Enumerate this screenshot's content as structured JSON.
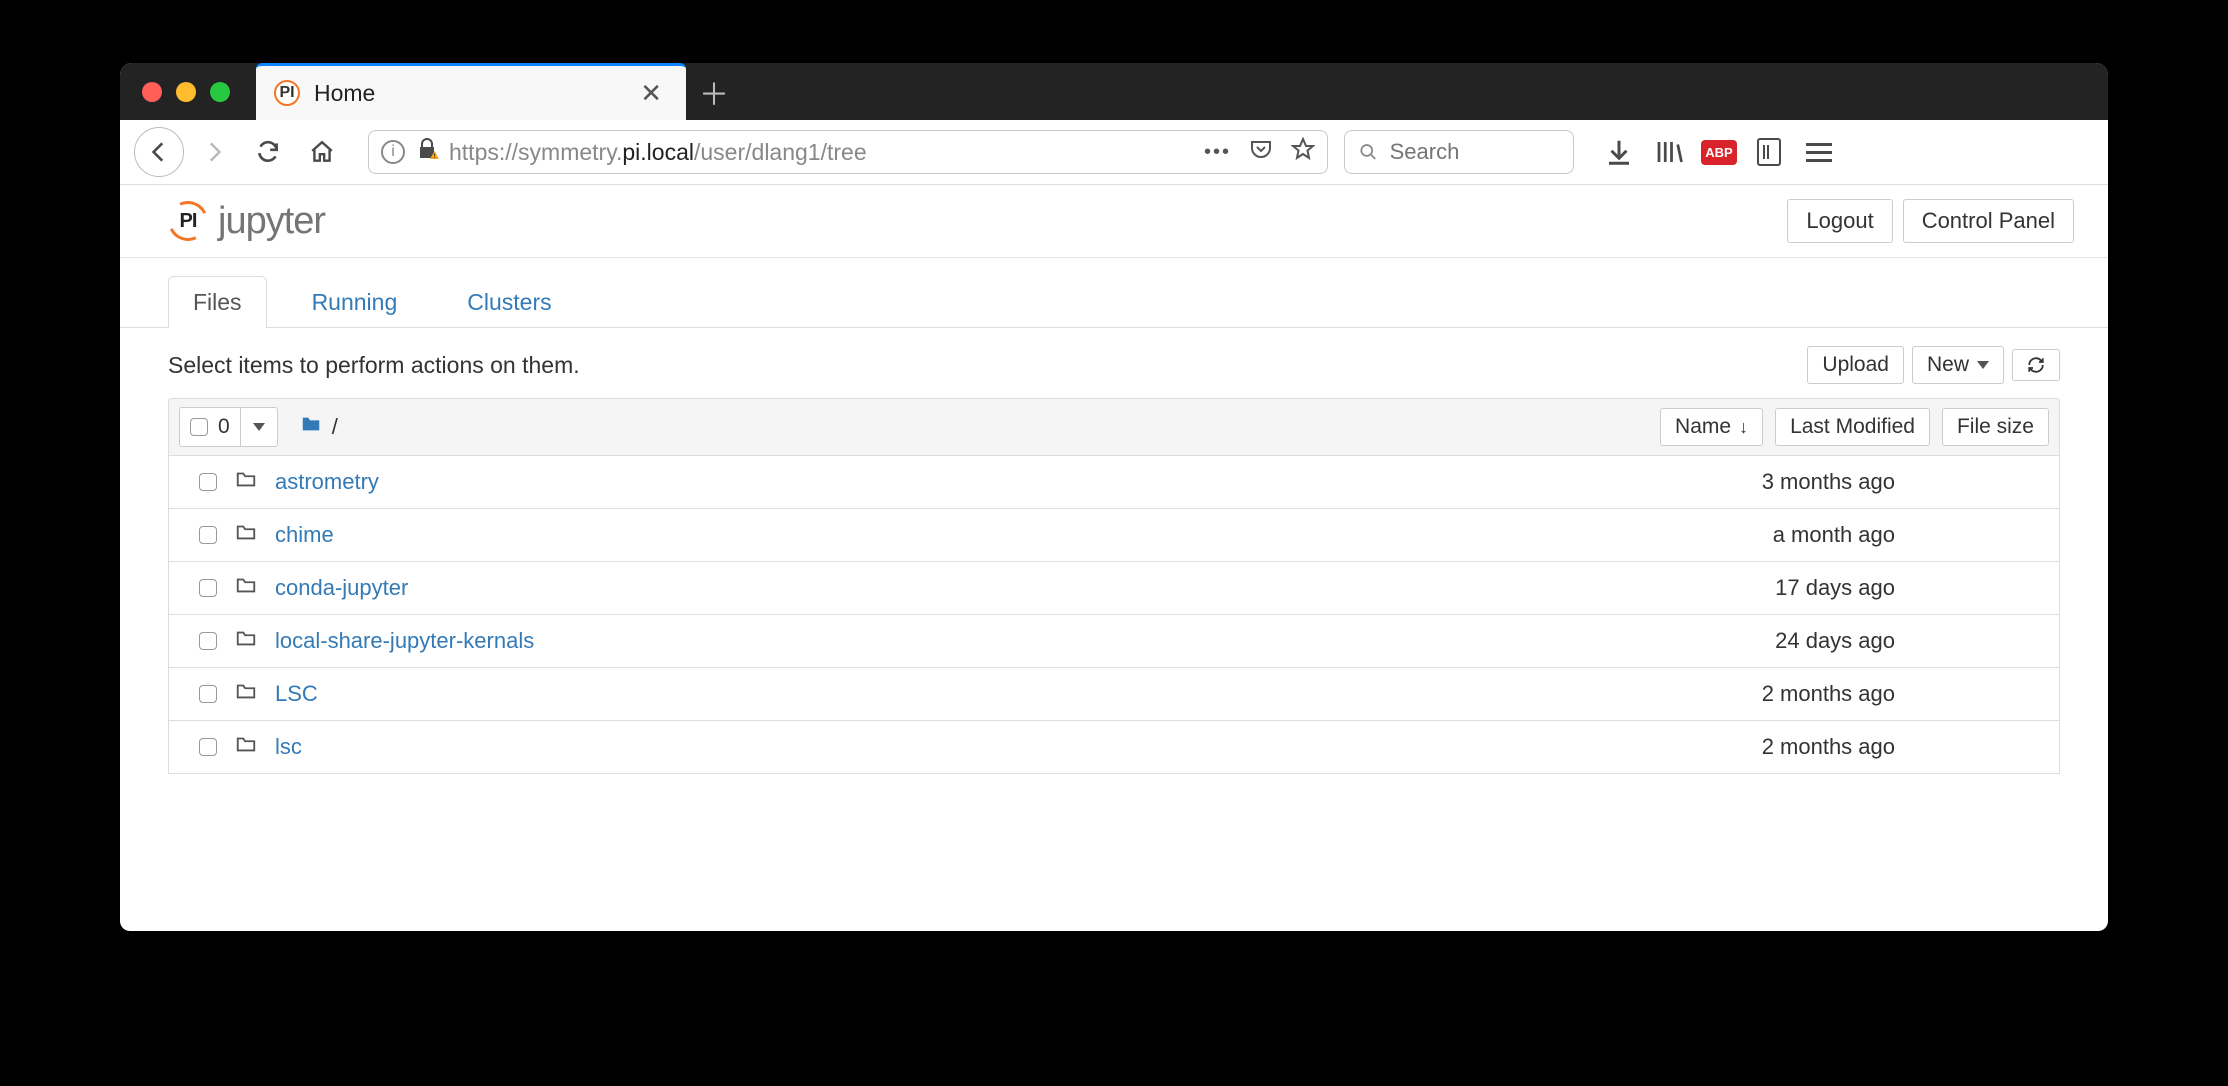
{
  "browser": {
    "tab_title": "Home",
    "url_prefix": "https://",
    "url_host_dim": "symmetry.",
    "url_host_bold": "pi.local",
    "url_path": "/user/dlang1/tree",
    "search_placeholder": "Search"
  },
  "jupyter": {
    "logo_text": "jupyter",
    "logout": "Logout",
    "control_panel": "Control Panel",
    "tabs": {
      "files": "Files",
      "running": "Running",
      "clusters": "Clusters"
    },
    "hint": "Select items to perform actions on them.",
    "upload": "Upload",
    "new": "New",
    "select_count": "0",
    "breadcrumb_slash": "/",
    "sort_name": "Name",
    "sort_modified": "Last Modified",
    "sort_size": "File size",
    "rows": [
      {
        "name": "astrometry",
        "modified": "3 months ago",
        "size": ""
      },
      {
        "name": "chime",
        "modified": "a month ago",
        "size": ""
      },
      {
        "name": "conda-jupyter",
        "modified": "17 days ago",
        "size": ""
      },
      {
        "name": "local-share-jupyter-kernals",
        "modified": "24 days ago",
        "size": ""
      },
      {
        "name": "LSC",
        "modified": "2 months ago",
        "size": ""
      },
      {
        "name": "lsc",
        "modified": "2 months ago",
        "size": ""
      }
    ]
  }
}
